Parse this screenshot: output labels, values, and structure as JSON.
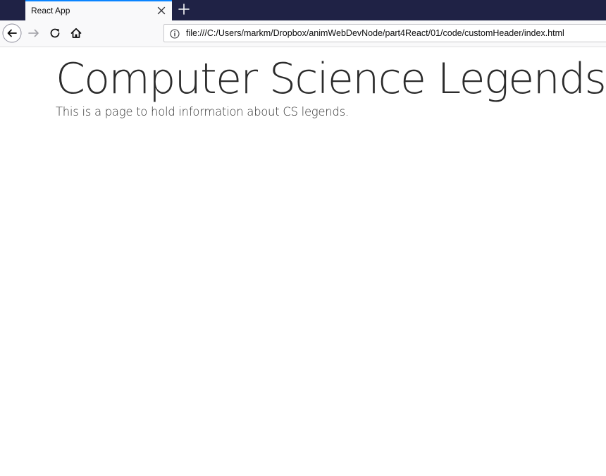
{
  "browser": {
    "tab": {
      "title": "React App",
      "close_icon": "close-icon",
      "new_tab_icon": "plus-icon"
    },
    "nav": {
      "back_icon": "back-arrow-icon",
      "forward_icon": "forward-arrow-icon",
      "reload_icon": "reload-icon",
      "home_icon": "home-icon"
    },
    "address_bar": {
      "info_icon": "info-icon",
      "url": "file:///C:/Users/markm/Dropbox/animWebDevNode/part4React/01/code/customHeader/index.html"
    },
    "colors": {
      "tabbar_bg": "#1f2245",
      "toolbar_bg": "#f9f9fa",
      "accent": "#0a84ff"
    }
  },
  "page": {
    "title": "Computer Science Legends",
    "subtitle": "This is a page to hold information about CS legends."
  }
}
